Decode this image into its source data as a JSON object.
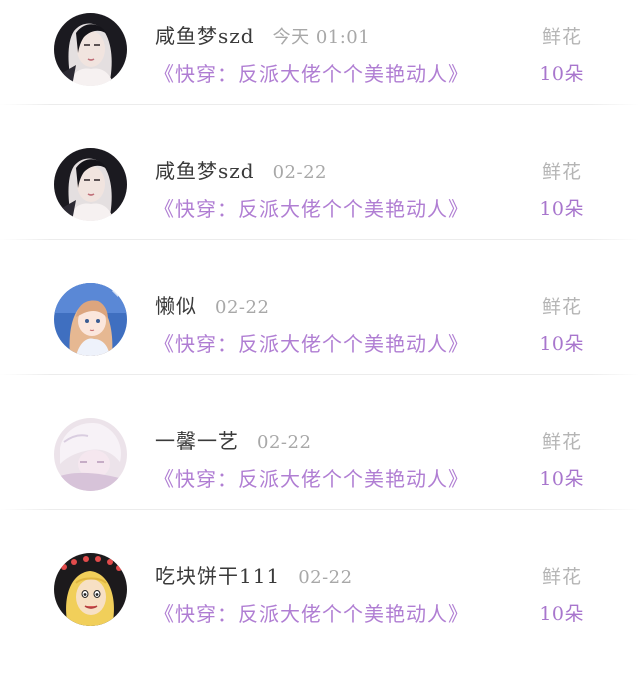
{
  "feed": {
    "items": [
      {
        "username": "咸鱼梦szd",
        "time": "今天 01:01",
        "book_title": "《快穿：反派大佬个个美艳动人》",
        "gift_type": "鲜花",
        "gift_count": "10朵",
        "avatar": "portrait-dark-hair"
      },
      {
        "username": "咸鱼梦szd",
        "time": "02-22",
        "book_title": "《快穿：反派大佬个个美艳动人》",
        "gift_type": "鲜花",
        "gift_count": "10朵",
        "avatar": "portrait-dark-hair"
      },
      {
        "username": "懒似",
        "time": "02-22",
        "book_title": "《快穿：反派大佬个个美艳动人》",
        "gift_type": "鲜花",
        "gift_count": "10朵",
        "avatar": "anime-girl-blue"
      },
      {
        "username": "一馨一艺",
        "time": "02-22",
        "book_title": "《快穿：反派大佬个个美艳动人》",
        "gift_type": "鲜花",
        "gift_count": "10朵",
        "avatar": "anime-pink-soft"
      },
      {
        "username": "吃块饼干111",
        "time": "02-22",
        "book_title": "《快穿：反派大佬个个美艳动人》",
        "gift_type": "鲜花",
        "gift_count": "10朵",
        "avatar": "cartoon-blonde-dark"
      }
    ]
  },
  "colors": {
    "username": "#3a3a3a",
    "time": "#a8a8a8",
    "book_title": "#b07ed3",
    "gift_type": "#b5b5b5",
    "gift_count": "#a876cd"
  }
}
